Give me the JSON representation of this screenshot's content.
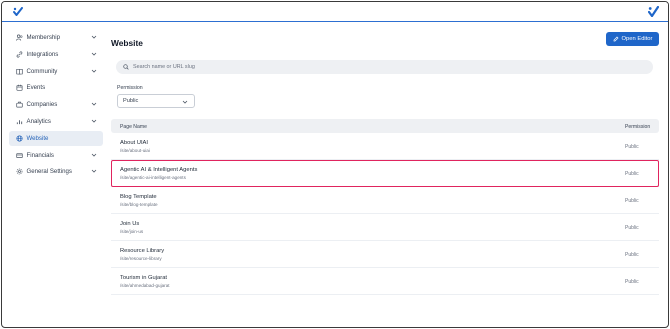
{
  "colors": {
    "accent": "#1f66c9",
    "highlight": "#e0245e",
    "active_bg": "#e8edf4"
  },
  "sidebar": {
    "items": [
      {
        "label": "Membership",
        "icon": "users-icon",
        "has_chevron": true
      },
      {
        "label": "Integrations",
        "icon": "link-icon",
        "has_chevron": true
      },
      {
        "label": "Community",
        "icon": "book-icon",
        "has_chevron": true
      },
      {
        "label": "Events",
        "icon": "calendar-icon",
        "has_chevron": false
      },
      {
        "label": "Companies",
        "icon": "briefcase-icon",
        "has_chevron": true
      },
      {
        "label": "Analytics",
        "icon": "bar-chart-icon",
        "has_chevron": true
      },
      {
        "label": "Website",
        "icon": "globe-icon",
        "has_chevron": false,
        "active": true
      },
      {
        "label": "Financials",
        "icon": "credit-card-icon",
        "has_chevron": true
      },
      {
        "label": "General Settings",
        "icon": "gear-icon",
        "has_chevron": true
      }
    ]
  },
  "main": {
    "title": "Website",
    "open_editor_label": "Open Editor",
    "search_placeholder": "Search name or URL slug",
    "permission_label": "Permission",
    "permission_value": "Public",
    "table": {
      "headers": [
        "Page Name",
        "Permission"
      ],
      "rows": [
        {
          "name": "About UIAI",
          "slug": "/site/about-uiai",
          "permission": "Public"
        },
        {
          "name": "Agentic AI & Intelligent Agents",
          "slug": "/site/agentic-ai-intelligent-agents",
          "permission": "Public",
          "highlighted": true
        },
        {
          "name": "Blog Template",
          "slug": "/site/blog-template",
          "permission": "Public"
        },
        {
          "name": "Join Us",
          "slug": "/site/join-us",
          "permission": "Public"
        },
        {
          "name": "Resource Library",
          "slug": "/site/resource-library",
          "permission": "Public"
        },
        {
          "name": "Tourism in Gujarat",
          "slug": "/site/ahmedabad-gujarat",
          "permission": "Public"
        }
      ]
    }
  }
}
